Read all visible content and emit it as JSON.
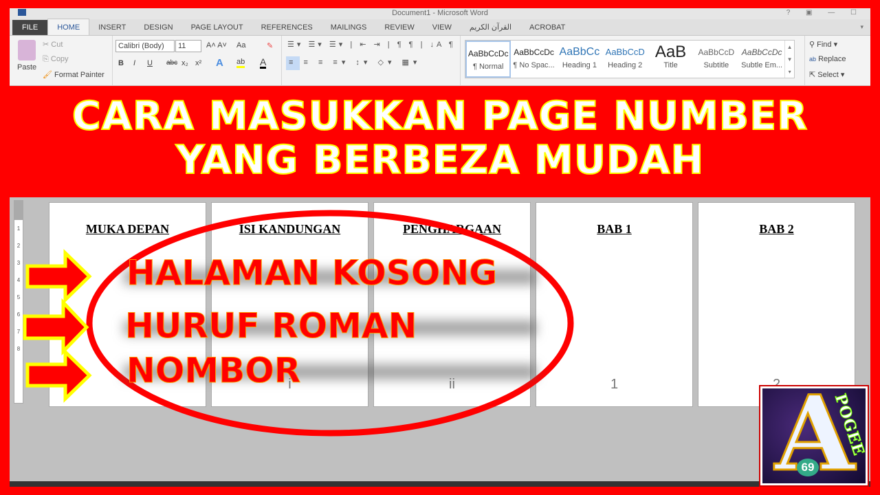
{
  "window": {
    "title": "Document1 - Microsoft Word"
  },
  "tabs": [
    "FILE",
    "HOME",
    "INSERT",
    "DESIGN",
    "PAGE LAYOUT",
    "REFERENCES",
    "MAILINGS",
    "REVIEW",
    "VIEW",
    "القرآن الكريم",
    "ACROBAT"
  ],
  "clipboard": {
    "paste": "Paste",
    "cut": "Cut",
    "copy": "Copy",
    "format_painter": "Format Painter"
  },
  "font": {
    "name": "Calibri (Body)",
    "size": "11",
    "bold": "B",
    "italic": "I",
    "underline": "U",
    "strike": "abc",
    "sub": "x₂",
    "sup": "x²",
    "case": "Aa"
  },
  "styles": [
    {
      "preview": "AaBbCcDc",
      "name": "¶ Normal",
      "color": "#222222"
    },
    {
      "preview": "AaBbCcDc",
      "name": "¶ No Spac...",
      "color": "#222222"
    },
    {
      "preview": "AaBbCc",
      "name": "Heading 1",
      "color": "#2e74b5"
    },
    {
      "preview": "AaBbCcD",
      "name": "Heading 2",
      "color": "#2e74b5"
    },
    {
      "preview": "AaB",
      "name": "Title",
      "color": "#222222"
    },
    {
      "preview": "AaBbCcD",
      "name": "Subtitle",
      "color": "#666666"
    },
    {
      "preview": "AaBbCcDc",
      "name": "Subtle Em...",
      "color": "#555555"
    }
  ],
  "editing": {
    "find": "Find",
    "replace": "Replace",
    "select": "Select"
  },
  "banner": {
    "line1": "CARA MASUKKAN PAGE NUMBER",
    "line2": "YANG BERBEZA MUDAH"
  },
  "pages": [
    {
      "heading": "MUKA DEPAN",
      "number": ""
    },
    {
      "heading": "ISI KANDUNGAN",
      "number": "i"
    },
    {
      "heading": "PENGHARGAAN",
      "number": "ii"
    },
    {
      "heading": "BAB 1",
      "number": "1"
    },
    {
      "heading": "BAB 2",
      "number": "2"
    }
  ],
  "ruler": [
    "1",
    "1",
    "2",
    "3",
    "4",
    "5",
    "6",
    "7",
    "8"
  ],
  "overlay": {
    "items": [
      "HALAMAN KOSONG",
      "HURUF ROMAN",
      "NOMBOR"
    ],
    "accent": "#ff0000"
  },
  "logo": {
    "letter": "A",
    "text": "POGEE",
    "number": "69"
  }
}
